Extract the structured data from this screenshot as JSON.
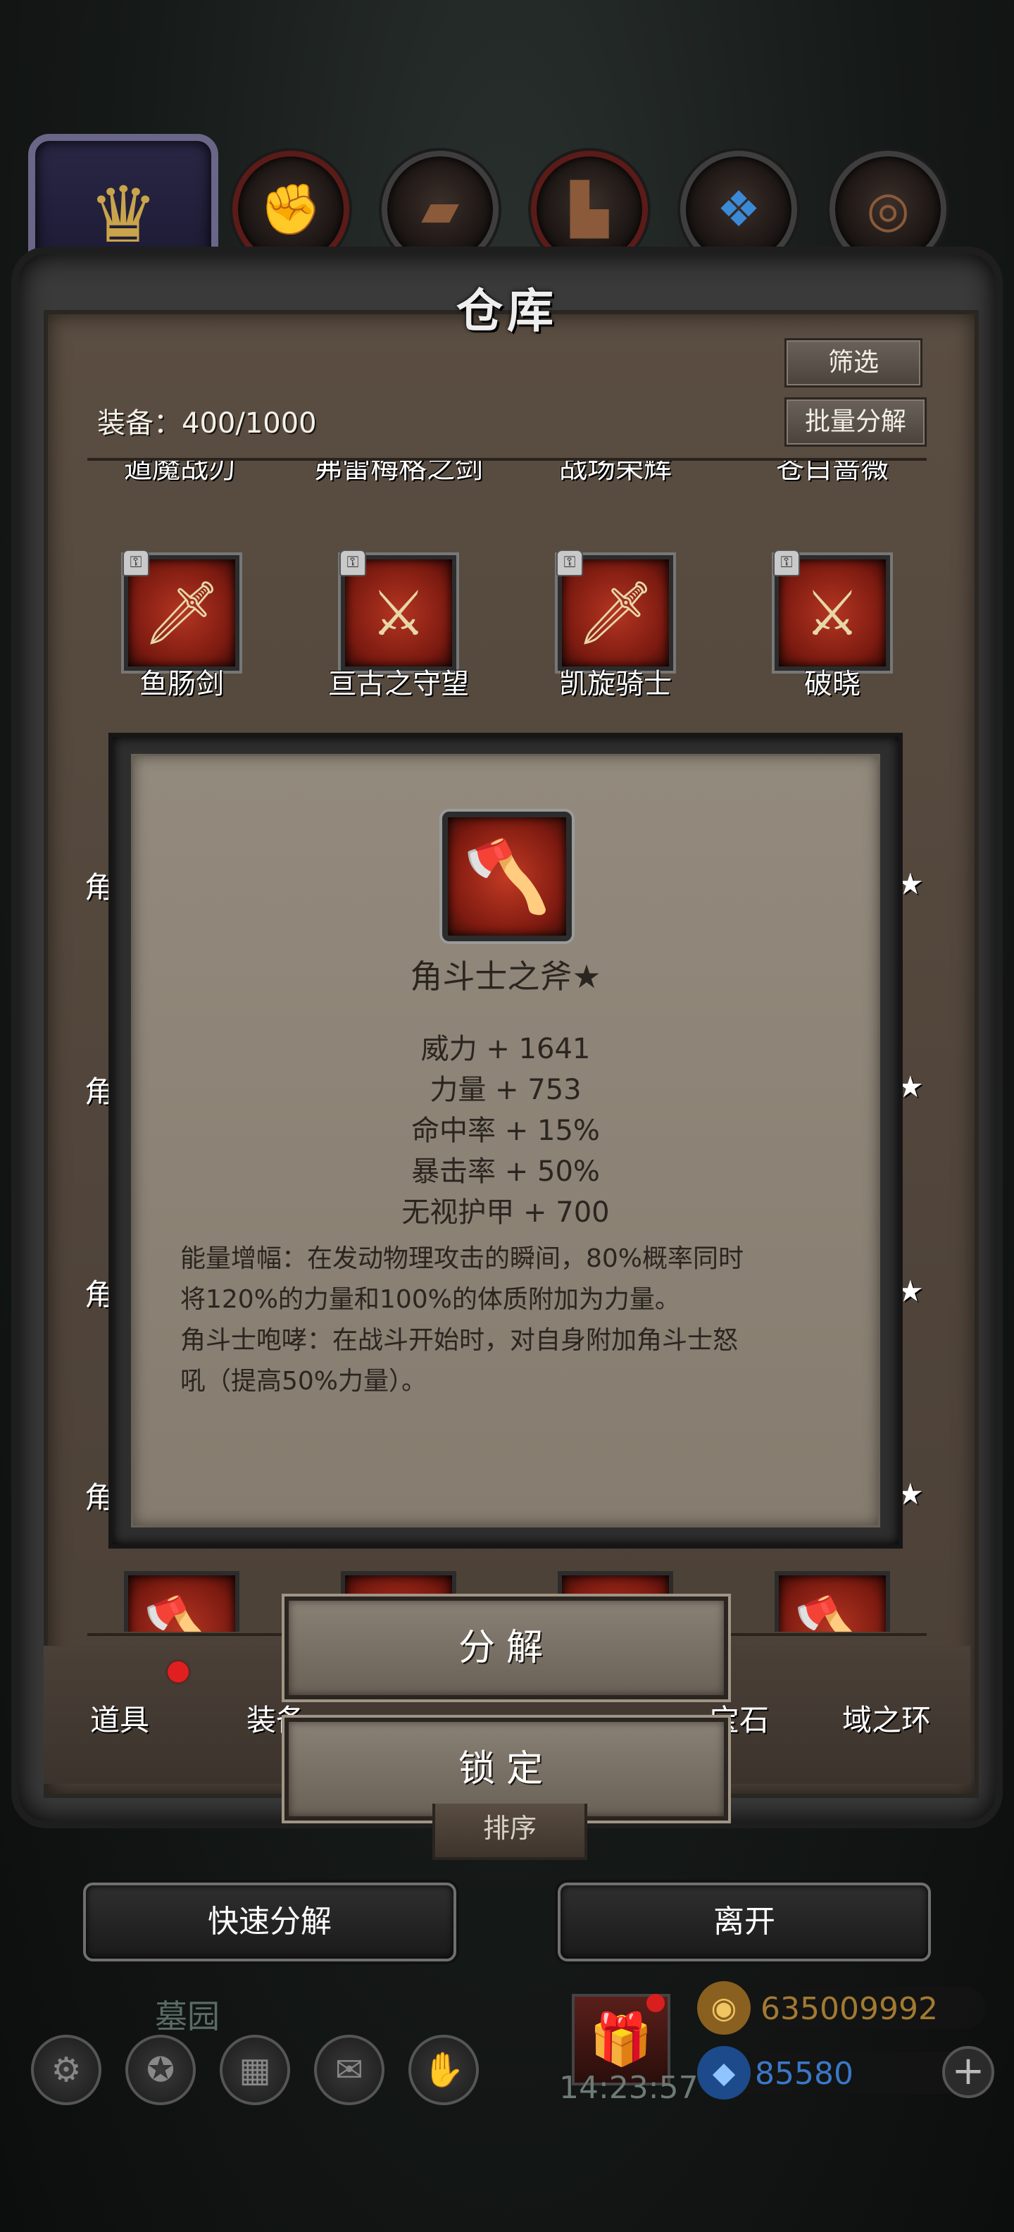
{
  "panel": {
    "title": "仓库",
    "filter_label": "筛选",
    "batch_label": "批量分解",
    "equip_count": "装备：400/1000"
  },
  "categories": [
    {
      "name": "crown-icon",
      "glyph": "♛"
    },
    {
      "name": "glove-icon",
      "glyph": "✊"
    },
    {
      "name": "armor-icon",
      "glyph": "▰"
    },
    {
      "name": "boots-icon",
      "glyph": "▙"
    },
    {
      "name": "gem-icon",
      "glyph": "❖"
    },
    {
      "name": "ring-icon",
      "glyph": "◎"
    }
  ],
  "top_row_names": [
    "遁魔战刃",
    "弗雷梅格之剑",
    "战场荣辉",
    "苍白蔷薇"
  ],
  "items_row": [
    {
      "label": "鱼肠剑",
      "icon": "sword-icon",
      "glyph": "🗡"
    },
    {
      "label": "亘古之守望",
      "icon": "sword-icon",
      "glyph": "⚔"
    },
    {
      "label": "凯旋骑士",
      "icon": "sword-icon",
      "glyph": "🗡"
    },
    {
      "label": "破晓",
      "icon": "sword-icon",
      "glyph": "⚔"
    }
  ],
  "hidden_rows": [
    {
      "left": "角",
      "star": "★"
    },
    {
      "left": "角",
      "star": "★"
    },
    {
      "left": "角",
      "star": "★"
    },
    {
      "left": "角",
      "star": "★"
    }
  ],
  "tooltip": {
    "name": "角斗士之斧★",
    "icon_glyph": "🪓",
    "stats": [
      "威力 + 1641",
      "力量 + 753",
      "命中率 + 15%",
      "暴击率 + 50%",
      "无视护甲 + 700"
    ],
    "desc": [
      "能量增幅：在发动物理攻击的瞬间，80%概率同时",
      "将120%的力量和100%的体质附加为力量。",
      "角斗士咆哮：在战斗开始时，对自身附加角斗士怒",
      "吼（提高50%力量）。"
    ]
  },
  "tabs": [
    "道具",
    "装备",
    "宝石",
    "域之环"
  ],
  "context_menu": {
    "decompose": "分解",
    "lock": "锁定"
  },
  "sort_label": "排序",
  "buttons": {
    "quick_decompose": "快速分解",
    "leave": "离开"
  },
  "hud": {
    "place": "墓园",
    "clock": "14:23:57",
    "gold": "635009992",
    "gems": "85580",
    "plus": "+"
  },
  "colors": {
    "gold": "#c38a2c",
    "gem": "#3a6fc0",
    "alert_dot": "#e02020"
  }
}
